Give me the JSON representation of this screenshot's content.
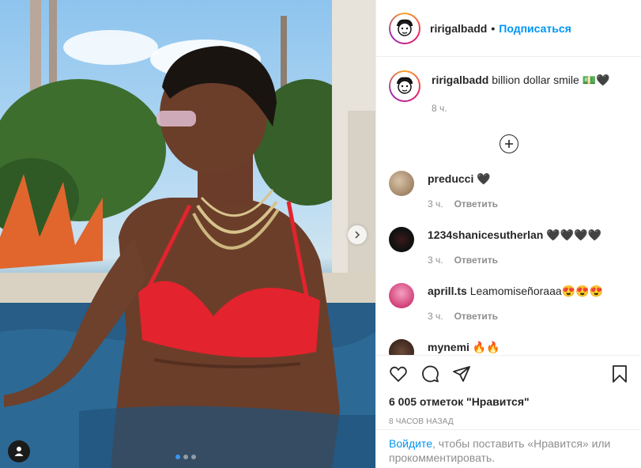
{
  "post": {
    "author": "ririgalbadd",
    "follow_label": "Подписаться",
    "separator": "•",
    "caption_text": "billion dollar smile 💵🖤",
    "caption_time": "8 ч.",
    "likes_text": "6 005 отметок \"Нравится\"",
    "posted_ago": "8 ЧАСОВ НАЗАД",
    "carousel": {
      "total": 3,
      "active": 1
    }
  },
  "comments": [
    {
      "user": "preducci",
      "text": "🖤",
      "time": "3 ч.",
      "reply_label": "Ответить"
    },
    {
      "user": "1234shanicesutherlan",
      "text": "🖤🖤🖤🖤",
      "time": "3 ч.",
      "reply_label": "Ответить"
    },
    {
      "user": "aprill.ts",
      "text": "Leamomiseñoraaa😍😍😍",
      "time": "3 ч.",
      "reply_label": "Ответить"
    },
    {
      "user": "mynemi",
      "text": "🔥🔥",
      "time": "",
      "reply_label": ""
    }
  ],
  "login_prompt": {
    "link": "Войдите",
    "text": ", чтобы поставить «Нравится» или прокомментировать."
  },
  "icons": {
    "like": "heart-outline-icon",
    "comment": "comment-bubble-icon",
    "share": "paper-plane-icon",
    "save": "bookmark-icon",
    "load_more": "plus-circle-icon",
    "next": "chevron-right-icon",
    "tag": "user-tag-icon"
  },
  "colors": {
    "accent": "#0095f6",
    "text": "#262626",
    "muted": "#8e8e8e",
    "border": "#efefef"
  }
}
